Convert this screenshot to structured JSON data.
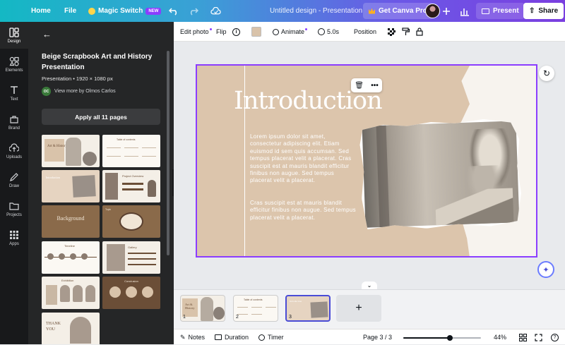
{
  "topbar": {
    "home": "Home",
    "file": "File",
    "magic_switch": "Magic Switch",
    "new_badge": "NEW",
    "doc_title": "Untitled design - Presentation",
    "get_pro": "Get Canva Pro",
    "present": "Present",
    "share": "Share"
  },
  "rail": {
    "items": [
      {
        "label": "Design",
        "icon": "design-icon"
      },
      {
        "label": "Elements",
        "icon": "elements-icon"
      },
      {
        "label": "Text",
        "icon": "text-icon"
      },
      {
        "label": "Brand",
        "icon": "brand-icon"
      },
      {
        "label": "Uploads",
        "icon": "uploads-icon"
      },
      {
        "label": "Draw",
        "icon": "draw-icon"
      },
      {
        "label": "Projects",
        "icon": "projects-icon"
      },
      {
        "label": "Apps",
        "icon": "apps-icon"
      }
    ]
  },
  "panel": {
    "title_line1": "Beige Scrapbook Art and History",
    "title_line2": "Presentation",
    "meta": "Presentation • 1920 × 1080 px",
    "author_initials": "OC",
    "author": "View more by Olmos Carlos",
    "apply_all": "Apply all 11 pages",
    "thumbs": [
      {
        "text": "Art & History"
      },
      {
        "text": "Table of contents"
      },
      {
        "text": "Introduction"
      },
      {
        "text": "Project Overview"
      },
      {
        "text": "Background"
      },
      {
        "text": "Topic"
      },
      {
        "text": "Timeline"
      },
      {
        "text": "Gallery"
      },
      {
        "text": "Exhibition"
      },
      {
        "text": "Conclusion"
      },
      {
        "text": "THANK YOU"
      }
    ]
  },
  "toolbar": {
    "edit_photo": "Edit photo",
    "flip": "Flip",
    "animate": "Animate",
    "duration": "5.0s",
    "position": "Position"
  },
  "slide": {
    "title": "Introduction",
    "para1": "Lorem ipsum dolor sit amet, consectetur adipiscing elit. Etiam euismod id sem quis accumsan. Sed tempus placerat velit a placerat. Cras suscipit est at mauris blandit efficitur finibus non augue. Sed tempus placerat velit a placerat.",
    "para2": "Cras suscipit est at mauris blandit efficitur finibus non augue. Sed tempus placerat velit a placerat."
  },
  "filmstrip": {
    "pages": [
      {
        "num": "1",
        "text": "Art & History"
      },
      {
        "num": "2",
        "text": "Table of contents"
      },
      {
        "num": "3",
        "text": "Introduction"
      }
    ],
    "add": "+"
  },
  "statusbar": {
    "notes": "Notes",
    "duration": "Duration",
    "timer": "Timer",
    "page": "Page 3 / 3",
    "zoom": "44%",
    "zoom_value": 0.6
  },
  "colors": {
    "accent": "#8b3dff",
    "beige": "#d9c3aa",
    "brown": "#6b4e37"
  }
}
